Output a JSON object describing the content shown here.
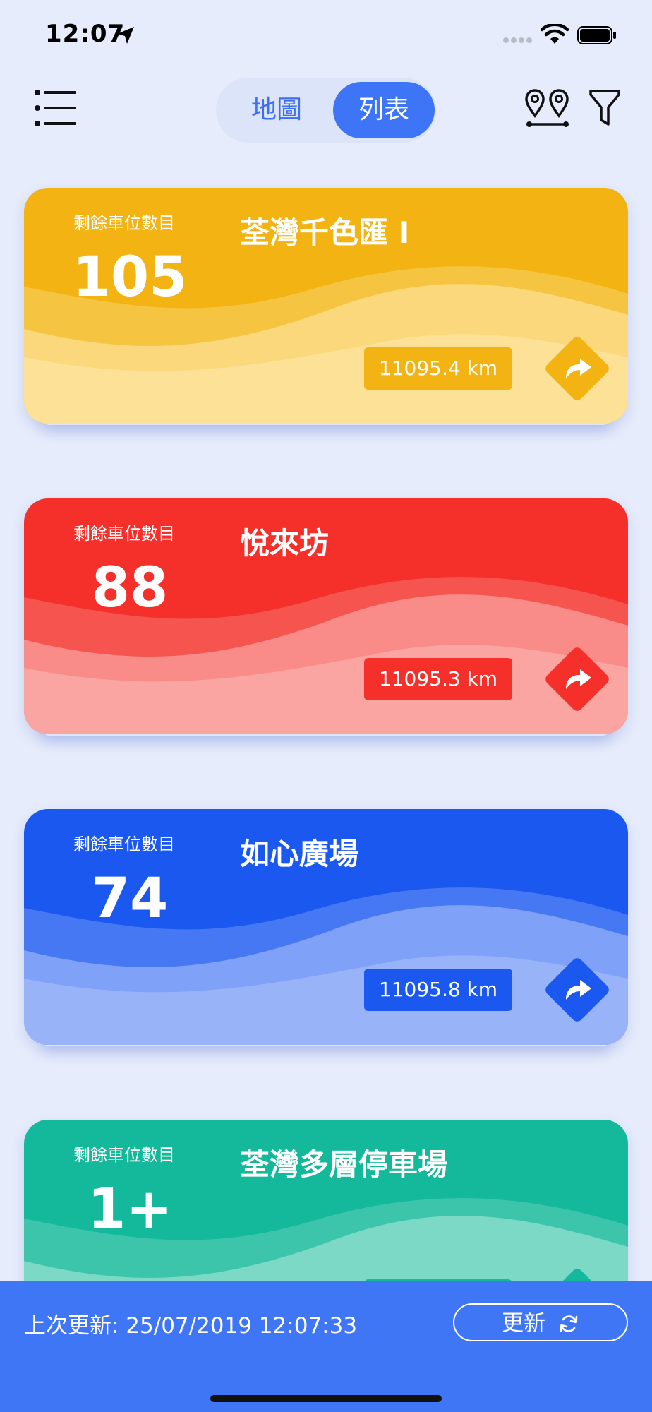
{
  "status_bar": {
    "time": "12:07"
  },
  "header": {
    "segments": {
      "map": "地圖",
      "list": "列表",
      "selected": "list"
    }
  },
  "cards": [
    {
      "label": "剩餘車位數目",
      "count": "105",
      "name": "荃灣千色匯 I",
      "distance": "11095.4 km",
      "color": "#f2b313"
    },
    {
      "label": "剩餘車位數目",
      "count": "88",
      "name": "悅來坊",
      "distance": "11095.3 km",
      "color": "#f5302b"
    },
    {
      "label": "剩餘車位數目",
      "count": "74",
      "name": "如心廣場",
      "distance": "11095.8 km",
      "color": "#1a58f0"
    },
    {
      "label": "剩餘車位數目",
      "count": "1+",
      "name": "荃灣多層停車場",
      "distance": "",
      "color": "#14b89a"
    }
  ],
  "footer": {
    "last_update": "上次更新: 25/07/2019 12:07:33",
    "refresh_label": "更新"
  }
}
